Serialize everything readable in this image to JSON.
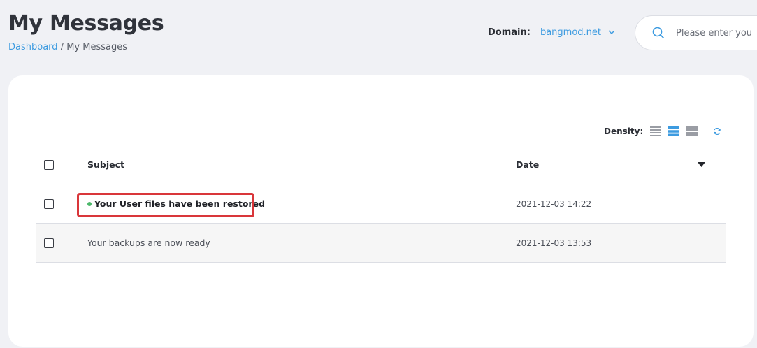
{
  "header": {
    "title": "My Messages",
    "breadcrumb": {
      "link": "Dashboard",
      "separator": " / ",
      "current": "My Messages"
    },
    "domain_label": "Domain:",
    "domain_value": "bangmod.net",
    "search_placeholder": "Please enter you"
  },
  "toolbar": {
    "density_label": "Density:",
    "icons": [
      "density-compact-icon",
      "density-standard-icon",
      "density-comfortable-icon",
      "refresh-icon"
    ]
  },
  "table": {
    "columns": {
      "subject": "Subject",
      "date": "Date"
    },
    "rows": [
      {
        "subject": "Your User files have been restored",
        "date": "2021-12-03 14:22",
        "unread": true
      },
      {
        "subject": "Your backups are now ready",
        "date": "2021-12-03 13:53",
        "unread": false
      }
    ]
  },
  "colors": {
    "accent": "#3d9be0",
    "unread_dot": "#4cb86a",
    "highlight": "#d9363a",
    "background": "#f0f1f5"
  }
}
